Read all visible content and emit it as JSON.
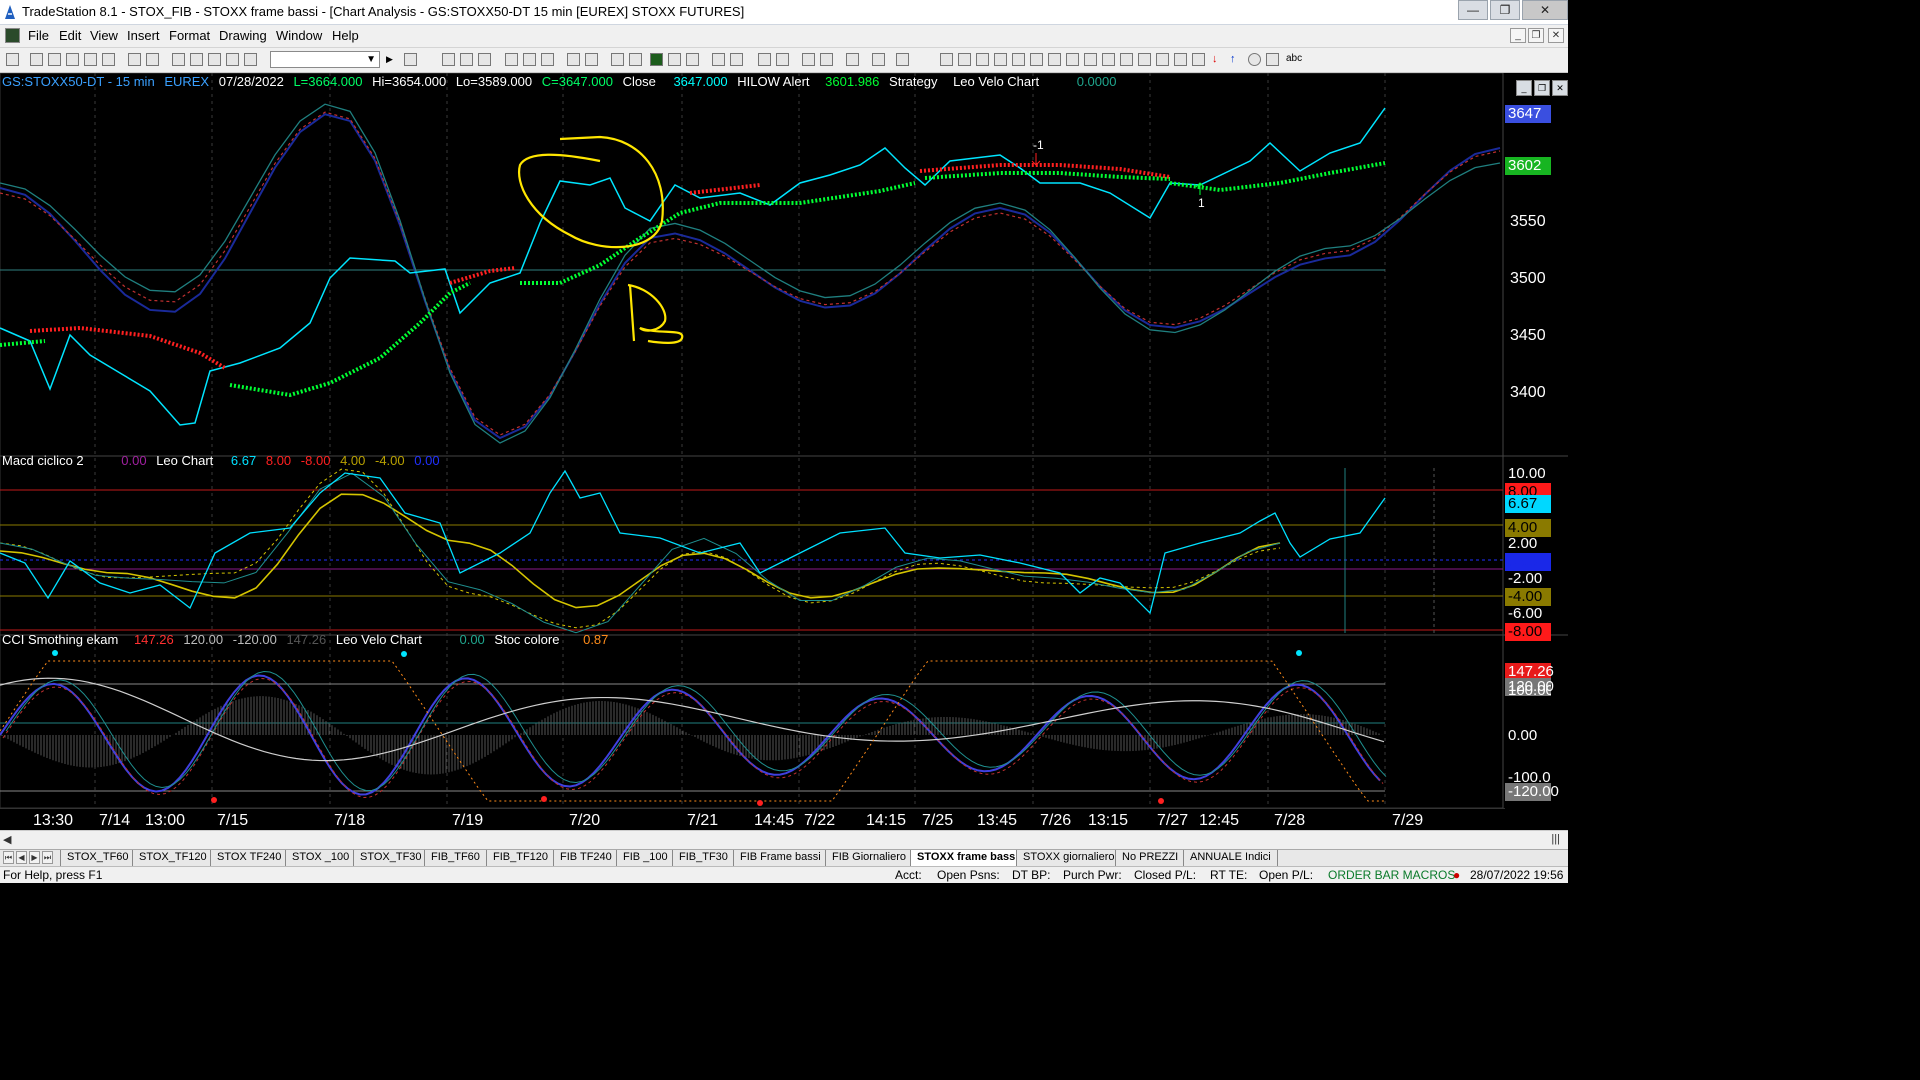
{
  "window": {
    "title": "TradeStation 8.1 - STOX_FIB - STOXX frame bassi - [Chart Analysis - GS:STOXX50-DT  15 min  [EUREX] STOXX FUTURES]"
  },
  "menu": [
    "File",
    "Edit",
    "View",
    "Insert",
    "Format",
    "Drawing",
    "Window",
    "Help"
  ],
  "toolbar": {
    "abc_label": "abc"
  },
  "chart": {
    "header": {
      "symbol": "GS:STOXX50-DT - 15 min",
      "exchange": "EUREX",
      "date": "07/28/2022",
      "last": "L=3664.000",
      "high": "Hi=3654.000",
      "low": "Lo=3589.000",
      "close_val": "C=3647.000",
      "close_lbl": "Close",
      "close_num": "3647.000",
      "hilow_lbl": "HILOW Alert",
      "hilow_num": "3601.986",
      "strategy_lbl": "Strategy",
      "leo_lbl": "Leo Velo Chart",
      "leo_num": "0.0000"
    },
    "price_axis": [
      "3550",
      "3500",
      "3450",
      "3400"
    ],
    "price_tags": {
      "last": "3647",
      "hilow": "3602"
    },
    "markers": {
      "sell": "-1",
      "buy": "1"
    },
    "annotation_letter": "R",
    "colors": {
      "price_line": "#00e5ff",
      "hilow_up": "#00ff33",
      "hilow_down": "#ff2020",
      "annotation": "#ffe600"
    }
  },
  "macd": {
    "name": "Macd ciclico 2",
    "v1": "0.00",
    "leo_lbl": "Leo Chart",
    "vals": [
      "6.67",
      "8.00",
      "-8.00",
      "4.00",
      "-4.00",
      "0.00"
    ],
    "axis": [
      "10.00",
      "8.00",
      "6.67",
      "4.00",
      "2.00",
      "0.00",
      "-2.00",
      "-4.00",
      "-6.00",
      "-8.00"
    ]
  },
  "cci": {
    "name": "CCI Smothing ekam",
    "v1": "147.26",
    "v2": "120.00",
    "v3": "-120.00",
    "v4": "147.26",
    "leo_lbl": "Leo Velo Chart",
    "v5": "0.00",
    "stoc_lbl": "Stoc colore",
    "v6": "0.87",
    "axis": [
      "147.26",
      "120.00",
      "100.00",
      "0.00",
      "-100.00",
      "-120.00"
    ]
  },
  "dates": [
    "13:30",
    "7/14",
    "13:00",
    "7/15",
    "7/18",
    "7/19",
    "7/20",
    "7/21",
    "14:45",
    "7/22",
    "14:15",
    "7/25",
    "13:45",
    "7/26",
    "13:15",
    "7/27",
    "12:45",
    "7/28",
    "7/29"
  ],
  "tabs": [
    "STOX_TF60",
    "STOX_TF120",
    "STOX TF240",
    "STOX _100",
    "STOX_TF30",
    "FIB_TF60",
    "FIB_TF120",
    "FIB TF240",
    "FIB _100",
    "FIB_TF30",
    "FIB Frame bassi",
    "FIB Giornaliero",
    "STOXX frame bassi",
    "STOXX giornaliero",
    "No PREZZI",
    "ANNUALE Indici"
  ],
  "active_tab": "STOXX frame bassi",
  "status": {
    "help": "For Help, press F1",
    "acct": "Acct:",
    "open_psns": "Open Psns:",
    "dt_bp": "DT BP:",
    "purch_pwr": "Purch Pwr:",
    "closed_pl": "Closed P/L:",
    "rt_te": "RT TE:",
    "open_pl": "Open P/L:",
    "macros": "ORDER BAR  MACROS",
    "datetime": "28/07/2022 19:56"
  }
}
